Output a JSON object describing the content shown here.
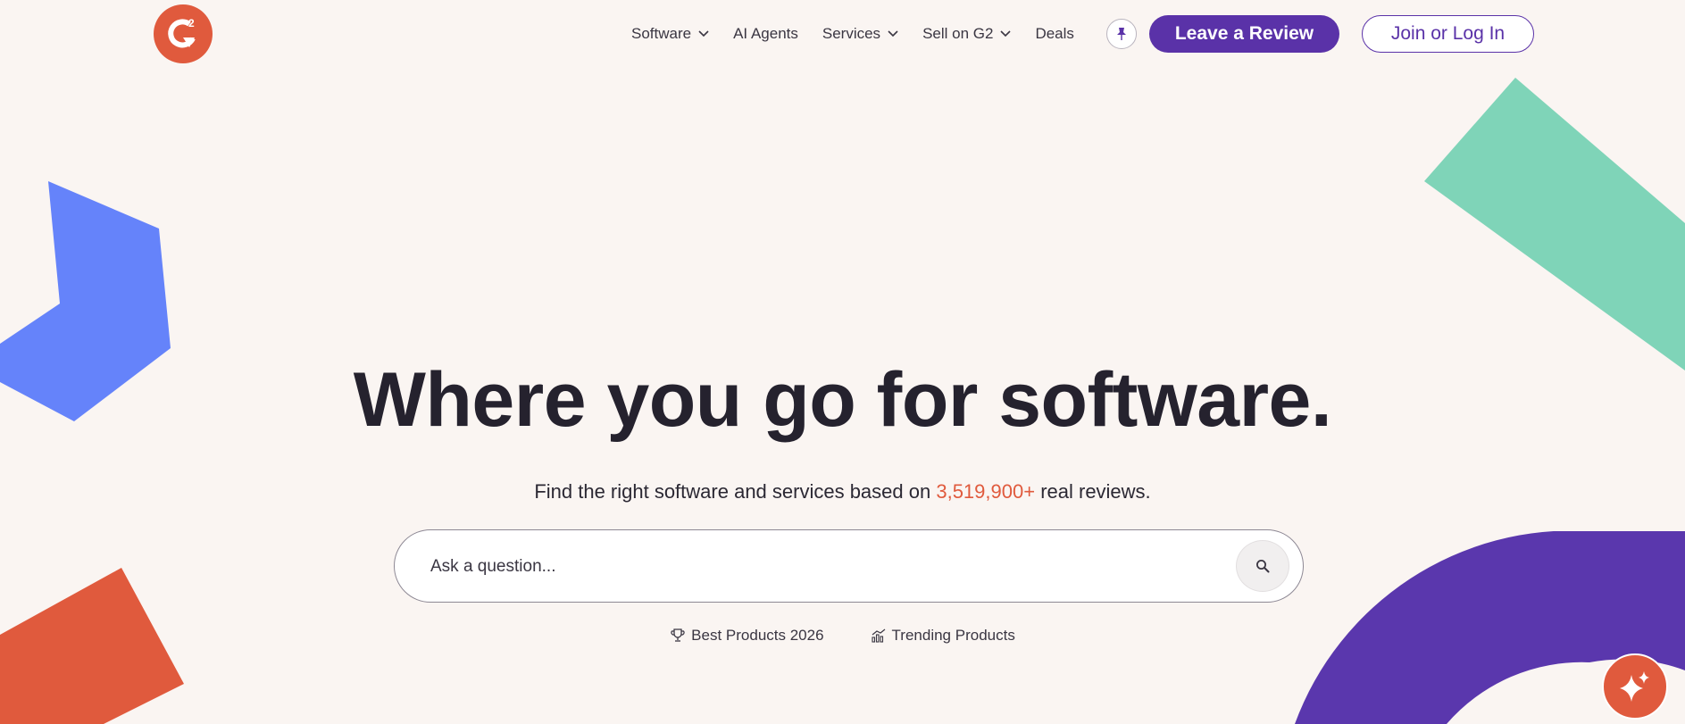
{
  "colors": {
    "brand_red": "#e05a3d",
    "brand_purple": "#5a32a8",
    "shape_blue": "#6583fa",
    "shape_green": "#7fd4b8",
    "background": "#faf5f2"
  },
  "header": {
    "logo_icon": "g2-logo-icon",
    "nav": {
      "software": "Software",
      "ai_agents": "AI Agents",
      "services": "Services",
      "sell": "Sell on G2",
      "deals": "Deals"
    },
    "pin_icon": "pin-icon",
    "review_label": "Leave a Review",
    "login_label": "Join or Log In"
  },
  "hero": {
    "title": "Where you go for software.",
    "sub_before": "Find the right software and services based on ",
    "sub_count": "3,519,900+",
    "sub_after": " real reviews."
  },
  "search": {
    "placeholder": "Ask a question...",
    "icon": "search-icon"
  },
  "quick_links": {
    "best_products": "Best Products 2026",
    "trending_products": "Trending Products"
  },
  "fab": {
    "icon": "sparkle-icon"
  }
}
